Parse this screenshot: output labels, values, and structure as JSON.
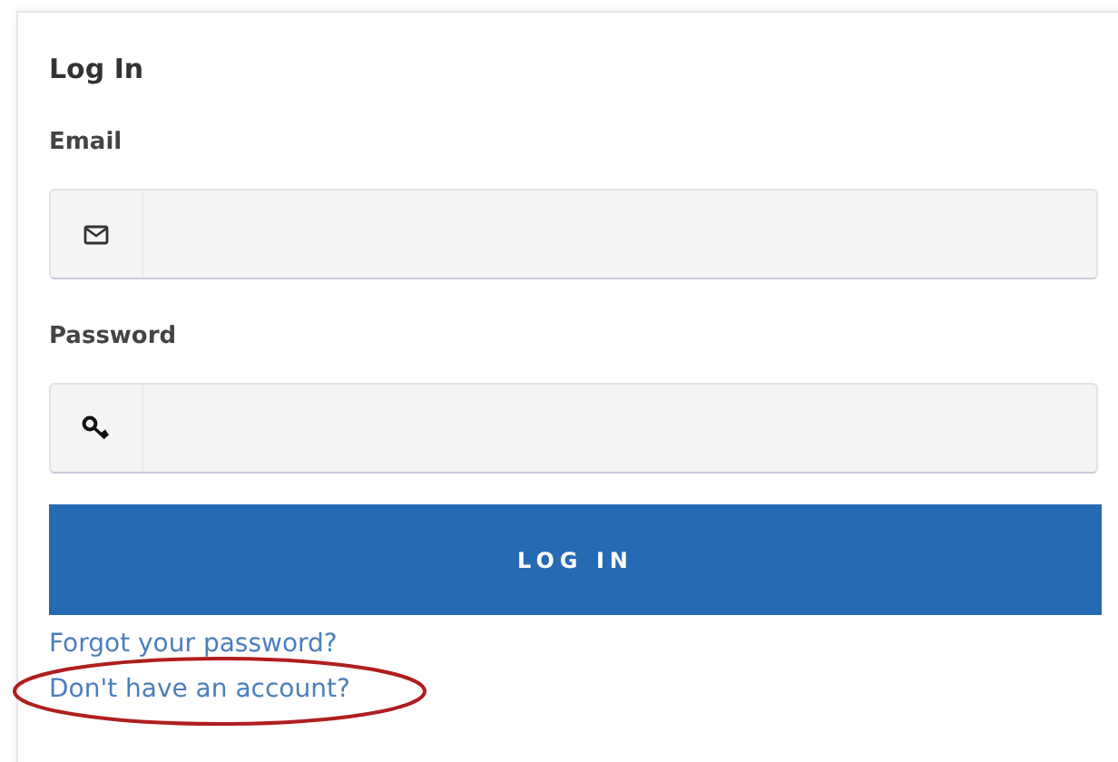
{
  "card": {
    "title": "Log In"
  },
  "fields": [
    {
      "label": "Email",
      "kind": "email"
    },
    {
      "label": "Password",
      "kind": "password"
    }
  ],
  "button": "LOG IN",
  "links": [
    {
      "text": "Forgot your password?",
      "circled": false
    },
    {
      "text": "Don't have an account?",
      "circled": true
    }
  ]
}
